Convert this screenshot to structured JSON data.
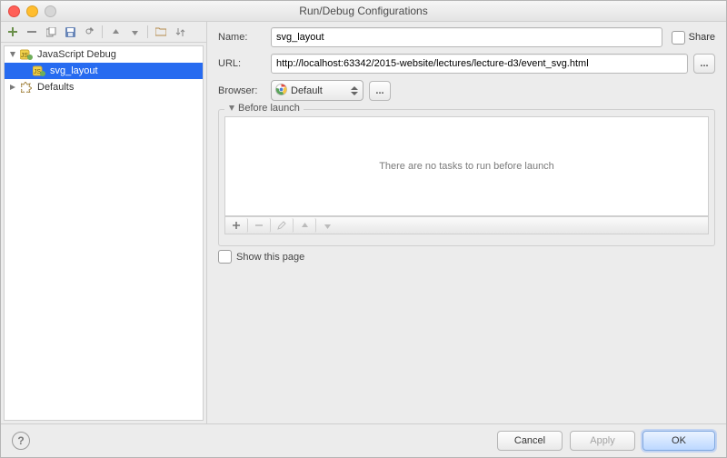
{
  "window": {
    "title": "Run/Debug Configurations"
  },
  "toolbar": {
    "add": "+",
    "remove": "−",
    "copy": "copy",
    "save": "save",
    "wrench": "wrench",
    "up": "up",
    "down": "down",
    "folder": "folder",
    "sort": "sort"
  },
  "tree": {
    "items": [
      {
        "label": "JavaScript Debug",
        "expanded": true,
        "children": [
          {
            "label": "svg_layout",
            "selected": true
          }
        ]
      },
      {
        "label": "Defaults",
        "expanded": false
      }
    ]
  },
  "form": {
    "name_label": "Name:",
    "name_value": "svg_layout",
    "share_label": "Share",
    "url_label": "URL:",
    "url_value": "http://localhost:63342/2015-website/lectures/lecture-d3/event_svg.html",
    "dots_label": "...",
    "browser_label": "Browser:",
    "browser_value": "Default"
  },
  "before_launch": {
    "legend": "Before launch",
    "empty_text": "There are no tasks to run before launch",
    "show_this_page_label": "Show this page"
  },
  "footer": {
    "help": "?",
    "cancel": "Cancel",
    "apply": "Apply",
    "ok": "OK"
  }
}
